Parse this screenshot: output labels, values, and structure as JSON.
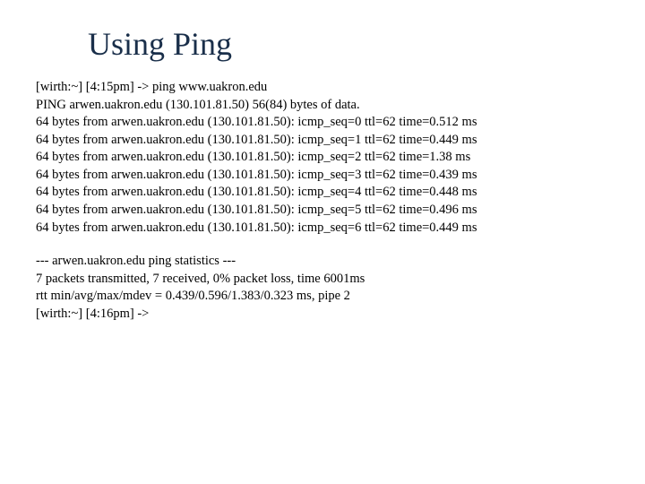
{
  "title": "Using Ping",
  "terminal": {
    "lines": [
      "[wirth:~] [4:15pm] -> ping www.uakron.edu",
      "PING arwen.uakron.edu (130.101.81.50) 56(84) bytes of data.",
      "64 bytes from arwen.uakron.edu (130.101.81.50): icmp_seq=0 ttl=62 time=0.512 ms",
      "64 bytes from arwen.uakron.edu (130.101.81.50): icmp_seq=1 ttl=62 time=0.449 ms",
      "64 bytes from arwen.uakron.edu (130.101.81.50): icmp_seq=2 ttl=62 time=1.38 ms",
      "64 bytes from arwen.uakron.edu (130.101.81.50): icmp_seq=3 ttl=62 time=0.439 ms",
      "64 bytes from arwen.uakron.edu (130.101.81.50): icmp_seq=4 ttl=62 time=0.448 ms",
      "64 bytes from arwen.uakron.edu (130.101.81.50): icmp_seq=5 ttl=62 time=0.496 ms",
      "64 bytes from arwen.uakron.edu (130.101.81.50): icmp_seq=6 ttl=62 time=0.449 ms"
    ]
  },
  "stats": {
    "lines": [
      "--- arwen.uakron.edu ping statistics ---",
      "7 packets transmitted, 7 received, 0% packet loss, time 6001ms",
      "rtt min/avg/max/mdev = 0.439/0.596/1.383/0.323 ms, pipe 2",
      "[wirth:~] [4:16pm] ->"
    ]
  }
}
